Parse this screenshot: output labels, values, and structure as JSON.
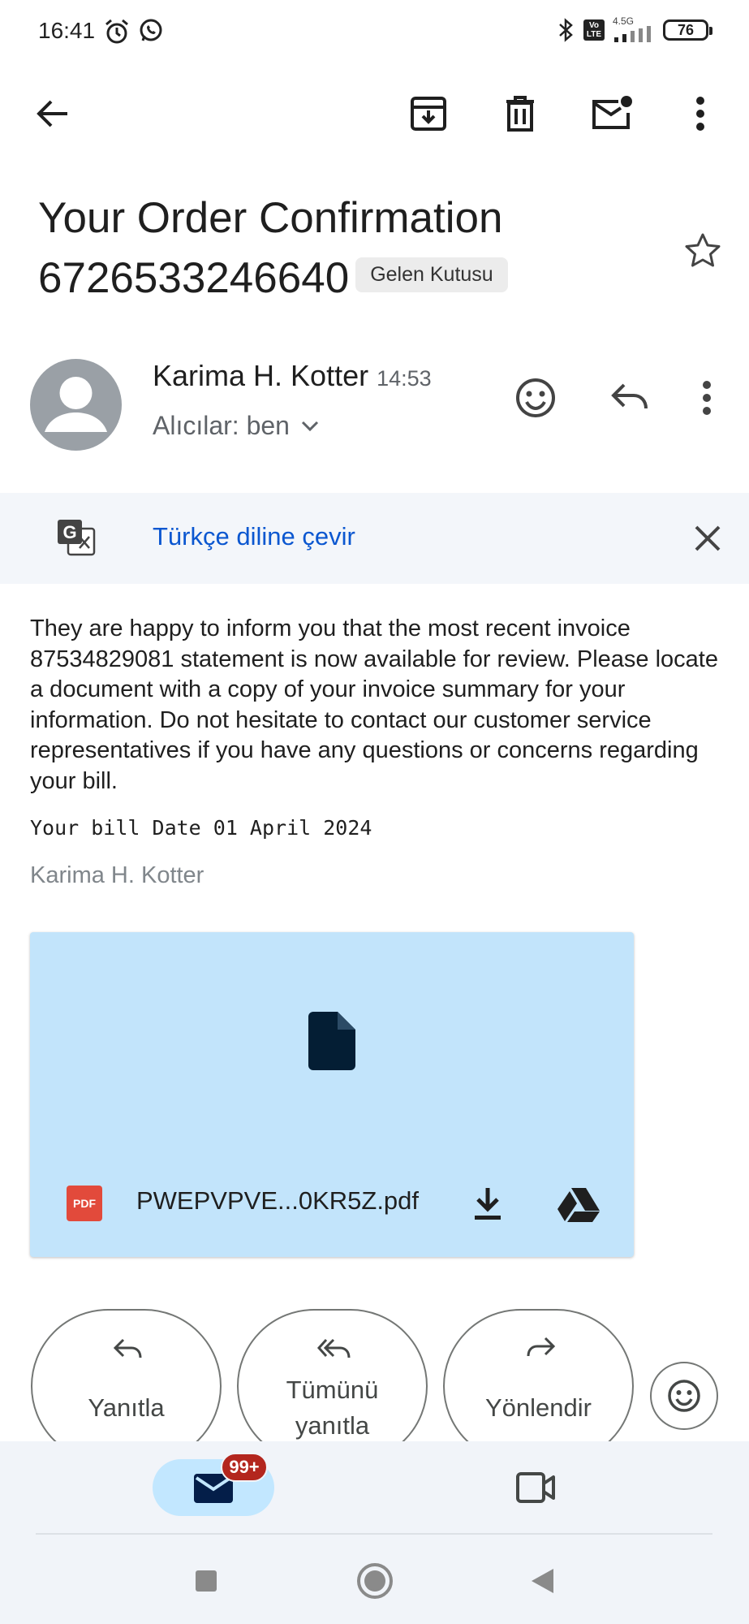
{
  "status_bar": {
    "time": "16:41",
    "network_label": "4.5G",
    "volte_label": "Vo LTE",
    "battery": "76"
  },
  "toolbar": {
    "back": "back-arrow-icon",
    "archive": "archive-icon",
    "delete": "trash-icon",
    "mark_unread": "mark-unread-icon",
    "more": "more-vert-icon"
  },
  "email": {
    "subject": "Your Order Confirmation 6726533246640",
    "label": "Gelen Kutusu",
    "sender_name": "Karima H. Kotter",
    "sender_time": "14:53",
    "recipients": "Alıcılar: ben",
    "body": "They are happy to inform you that the most recent invoice 87534829081 statement is now available for review. Please locate a document with a copy of your invoice summary for your information. Do not hesitate to contact our customer service representatives if you have any questions or concerns regarding your bill.",
    "bill_date": "Your bill Date 01 April 2024",
    "signature": "Karima H. Kotter"
  },
  "translate": {
    "link_text": "Türkçe diline çevir"
  },
  "attachment": {
    "badge": "PDF",
    "filename": "PWEPVPVE...0KR5Z.pdf"
  },
  "actions": {
    "reply": "Yanıtla",
    "reply_all_line1": "Tümünü",
    "reply_all_line2": "yanıtla",
    "forward": "Yönlendir"
  },
  "bottom_nav": {
    "mail_badge": "99+"
  },
  "colors": {
    "accent_blue": "#0b57d0",
    "attachment_bg": "#c2e4fb",
    "badge_red": "#b3261e",
    "nav_bg": "#f1f4f9"
  }
}
